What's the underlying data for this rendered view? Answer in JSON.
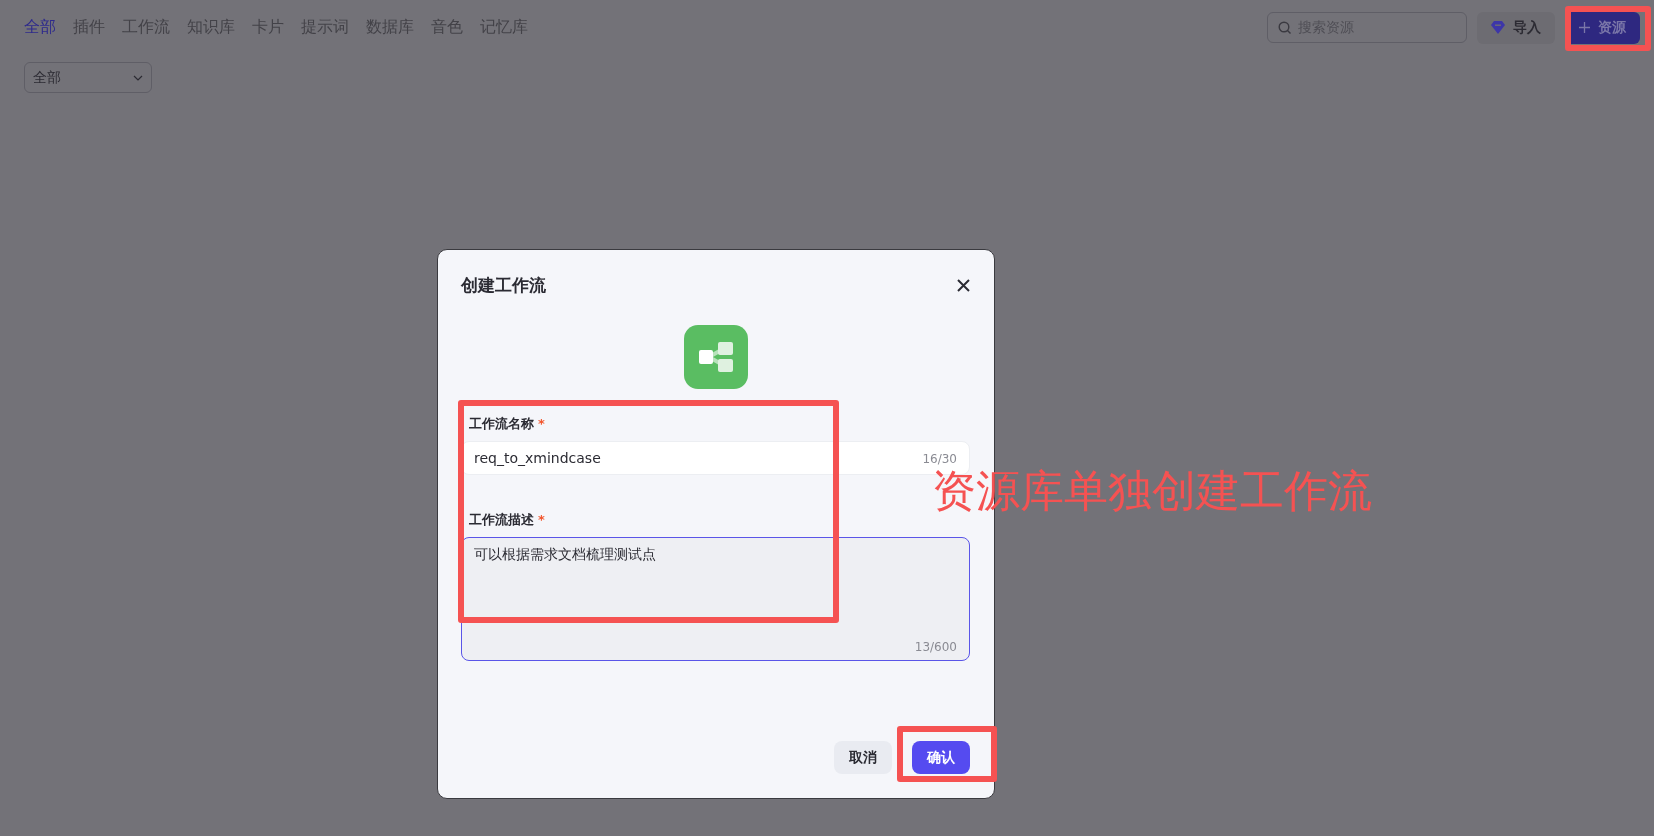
{
  "nav": {
    "tabs": [
      {
        "label": "全部",
        "selected": true
      },
      {
        "label": "插件",
        "selected": false
      },
      {
        "label": "工作流",
        "selected": false
      },
      {
        "label": "知识库",
        "selected": false
      },
      {
        "label": "卡片",
        "selected": false
      },
      {
        "label": "提示词",
        "selected": false
      },
      {
        "label": "数据库",
        "selected": false
      },
      {
        "label": "音色",
        "selected": false
      },
      {
        "label": "记忆库",
        "selected": false
      }
    ]
  },
  "filter": {
    "value": "全部"
  },
  "search": {
    "placeholder": "搜索资源"
  },
  "import_button": "导入",
  "create_button": "资源",
  "dialog": {
    "title": "创建工作流",
    "fields": [
      {
        "kind": "input",
        "label": "工作流名称",
        "required_mark": "*",
        "value": "req_to_xmindcase",
        "count": "16/30",
        "focused": false
      },
      {
        "kind": "textarea",
        "label": "工作流描述",
        "required_mark": "*",
        "value": "可以根据需求文档梳理测试点",
        "count": "13/600",
        "focused": true
      }
    ],
    "buttons": [
      {
        "label": "取消",
        "primary": false
      },
      {
        "label": "确认",
        "primary": true
      }
    ]
  },
  "annotation": {
    "text": "资源库单独创建工作流"
  }
}
